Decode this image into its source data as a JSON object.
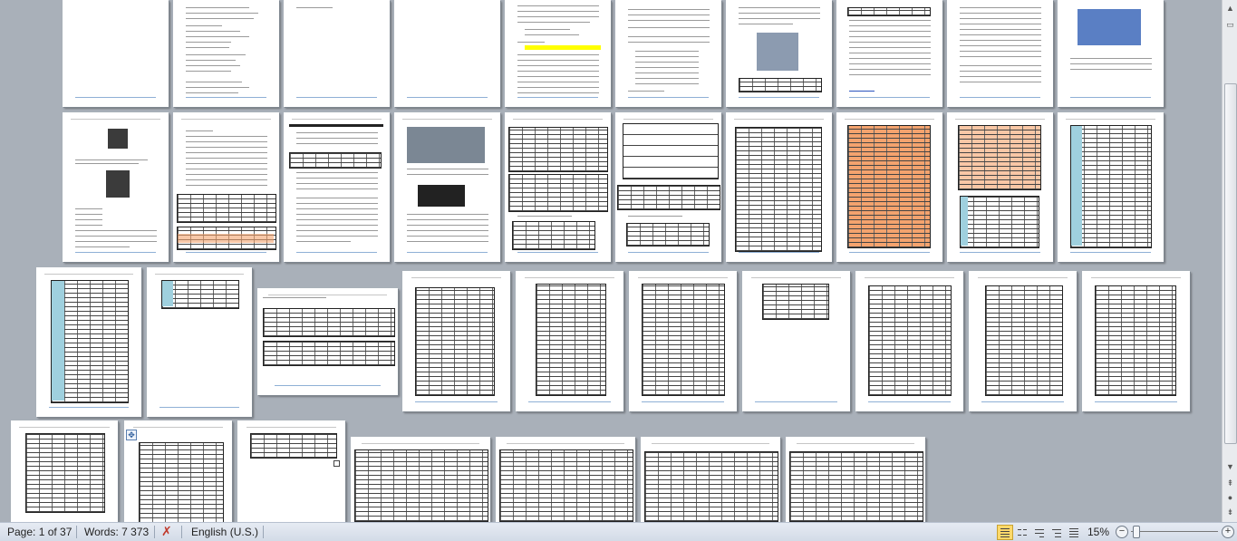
{
  "status_bar": {
    "page": "Page: 1 of 37",
    "words": "Words: 7 373",
    "language": "English (U.S.)",
    "zoom": "15%",
    "zoom_out": "−",
    "zoom_in": "+"
  },
  "document": {
    "total_pages": 37,
    "view_mode": "print-layout",
    "zoom_percent": 15
  },
  "colors": {
    "workspace": "#a9b0b9",
    "page": "#ffffff",
    "status_bar": "#dde3ec",
    "orange_cells": "#f4a36e",
    "blue_cells": "#9fd0de",
    "highlight": "#ffff00"
  },
  "icons": {
    "spelling": "spelling-check-icon",
    "scroll_up": "arrow-up-icon",
    "scroll_down": "arrow-down-icon",
    "move_handle": "table-move-handle-icon"
  }
}
